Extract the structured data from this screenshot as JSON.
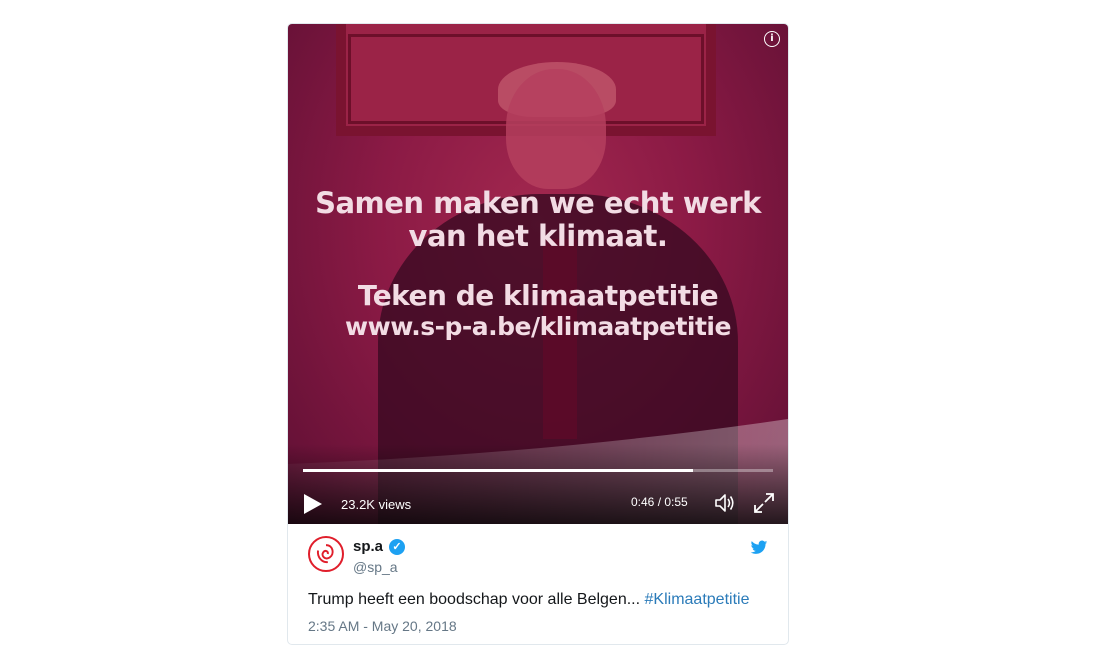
{
  "video": {
    "overlay_line1": "Samen maken we echt werk",
    "overlay_line2": "van het klimaat.",
    "overlay_line3": "Teken de klimaatpetitie",
    "overlay_line4": "www.s-p-a.be/klimaatpetitie",
    "info_icon": "i",
    "views": "23.2K views",
    "time": "0:46 / 0:55",
    "progress": 0.83,
    "icons": [
      "play-icon",
      "volume-icon",
      "fullscreen-icon",
      "info-icon"
    ]
  },
  "tweet": {
    "display_name": "sp.a",
    "verified_mark": "✓",
    "handle": "@sp_a",
    "text": "Trump heeft een boodschap voor alle Belgen... ",
    "hashtag": "#Klimaatpetitie",
    "timestamp": "2:35 AM - May 20, 2018",
    "brand_color": "#1da1f2",
    "logo_color": "#e01e2b"
  }
}
